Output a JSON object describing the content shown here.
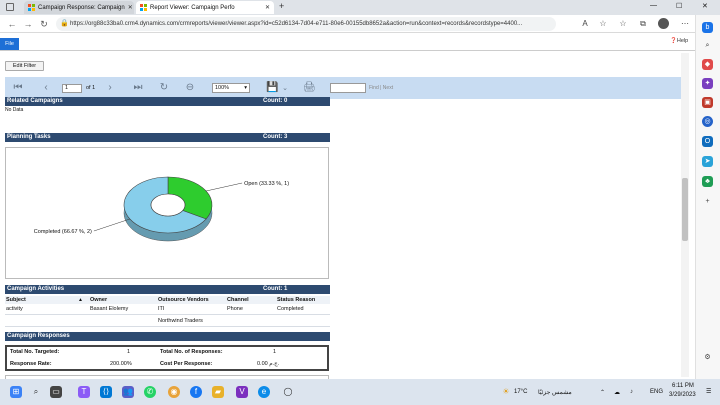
{
  "browser": {
    "tabs": [
      {
        "title": "Campaign Response: Campaign"
      },
      {
        "title": "Report Viewer: Campaign Perfo"
      }
    ],
    "new_tab_label": "+",
    "url": "https://org88c33ba0.crm4.dynamics.com/crmreports/viewer/viewer.aspx?id=c52d6134-7d04-e711-80e6-00155db8652a&action=run&context=records&recordstype=4400...",
    "window_controls": {
      "minimize": "—",
      "maximize": "☐",
      "close": "✕"
    }
  },
  "crm": {
    "file_tab": "File",
    "help_link": "Help"
  },
  "report": {
    "edit_filter": "Edit Filter",
    "page_value": "1",
    "page_of": "of 1",
    "zoom": "100%",
    "find_text": "Find | Next",
    "sections": {
      "related_campaigns": {
        "title": "Related Campaigns",
        "count": "Count:  0",
        "note": "No Data"
      },
      "planning_tasks": {
        "title": "Planning Tasks",
        "count": "Count:  3"
      },
      "campaign_activities": {
        "title": "Campaign Activities",
        "count": "Count:  1"
      },
      "campaign_responses": {
        "title": "Campaign Responses"
      }
    },
    "activities_columns": [
      "Subject",
      "Owner",
      "Outsource Vendors",
      "Channel",
      "Status Reason"
    ],
    "activities_sort_icon": "▲",
    "activities_rows": [
      [
        "activity",
        "Basant Elolemy",
        "ITI",
        "Phone",
        "Completed"
      ],
      [
        "",
        "",
        "Northwind Traders",
        "",
        ""
      ]
    ],
    "responses": {
      "total_targeted_label": "Total No. Targeted:",
      "total_targeted_value": "1",
      "total_responses_label": "Total No. of Responses:",
      "total_responses_value": "1",
      "response_rate_label": "Response Rate:",
      "response_rate_value": "200.00%",
      "cost_label": "Cost Per Response:",
      "cost_value": "0.00 ج.م."
    }
  },
  "chart_data": {
    "type": "pie",
    "categories": [
      "Open",
      "Completed"
    ],
    "values": [
      1,
      2
    ],
    "labels": [
      "Open (33.33 %, 1)",
      "Completed (66.67 %, 2)"
    ],
    "colors": [
      "#2ecc2e",
      "#87ceeb"
    ]
  },
  "taskbar": {
    "weather": "17°C",
    "weather_desc": "مشمس جزئيًا",
    "lang": "ENG",
    "time": "6:11 PM",
    "date": "3/29/2023"
  }
}
